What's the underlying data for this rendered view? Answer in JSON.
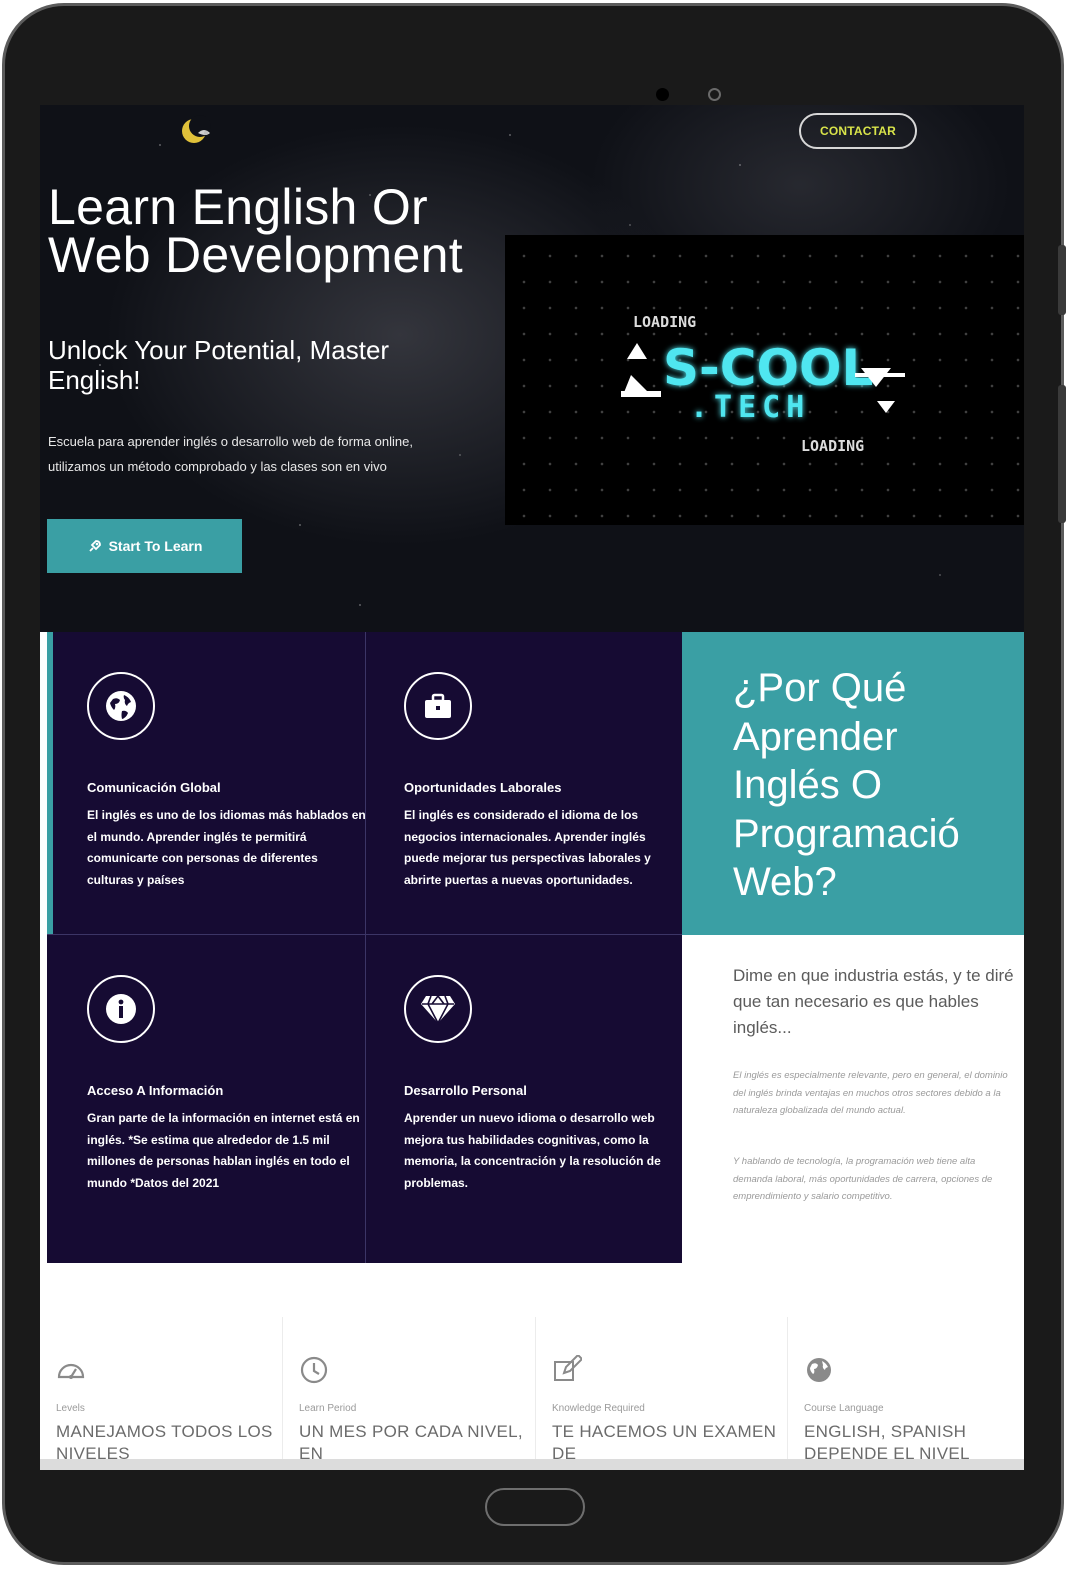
{
  "header": {
    "contact_label": "CONTACTAR"
  },
  "hero": {
    "title": "Learn English Or Web Development",
    "subtitle": "Unlock Your Potential, Master English!",
    "description": "Escuela para aprender inglés o desarrollo web de forma online, utilizamos un método comprobado y las clases son en vivo",
    "cta_label": "Start To Learn",
    "cta_icon": "rocket-icon"
  },
  "video": {
    "brand_line1": "S-COOL",
    "brand_line2": ".TECH",
    "loading_text": "LOADING"
  },
  "features": [
    {
      "icon": "globe-icon",
      "title": "Comunicación Global",
      "text": "El inglés es uno de los idiomas más hablados en el mundo. Aprender inglés te permitirá comunicarte con personas de diferentes culturas y países"
    },
    {
      "icon": "briefcase-icon",
      "title": "Oportunidades Laborales",
      "text": "El inglés es considerado el idioma de los negocios internacionales. Aprender inglés puede mejorar tus perspectivas laborales y abrirte puertas a nuevas oportunidades."
    },
    {
      "icon": "info-icon",
      "title": "Acceso A Información",
      "text": "Gran parte de la información en internet está en inglés. *Se estima que alrededor de 1.5 mil millones de personas hablan inglés en todo el mundo *Datos del 2021"
    },
    {
      "icon": "diamond-icon",
      "title": "Desarrollo Personal",
      "text": "Aprender un nuevo idioma o desarrollo web mejora tus habilidades cognitivas, como la memoria, la concentración y la resolución de problemas."
    }
  ],
  "why": {
    "title_lines": [
      "¿Por Qué",
      "Aprender",
      "Inglés O",
      "Programació",
      "Web?"
    ],
    "lead": "Dime en que industria estás, y te diré que tan necesario es que hables inglés...",
    "para1": "El inglés es especialmente relevante, pero en general, el dominio del inglés brinda ventajas en muchos otros sectores debido a la naturaleza globalizada del mundo actual.",
    "para2": "Y hablando de tecnología, la programación web tiene alta demanda laboral, más oportunidades de carrera, opciones de emprendimiento y salario competitivo."
  },
  "stats": [
    {
      "icon": "gauge-icon",
      "label": "Levels",
      "value": "MANEJAMOS TODOS LOS NIVELES"
    },
    {
      "icon": "clock-icon",
      "label": "Learn Period",
      "value": "UN MES POR CADA NIVEL, EN"
    },
    {
      "icon": "edit-icon",
      "label": "Knowledge Required",
      "value": "TE HACEMOS UN EXAMEN DE"
    },
    {
      "icon": "globe-icon",
      "label": "Course Language",
      "value": "ENGLISH, SPANISH DEPENDE EL NIVEL"
    }
  ],
  "colors": {
    "teal": "#3a9fa4",
    "navy": "#160b33",
    "contact_text": "#d9e44a",
    "neon": "#4fe6f0"
  }
}
